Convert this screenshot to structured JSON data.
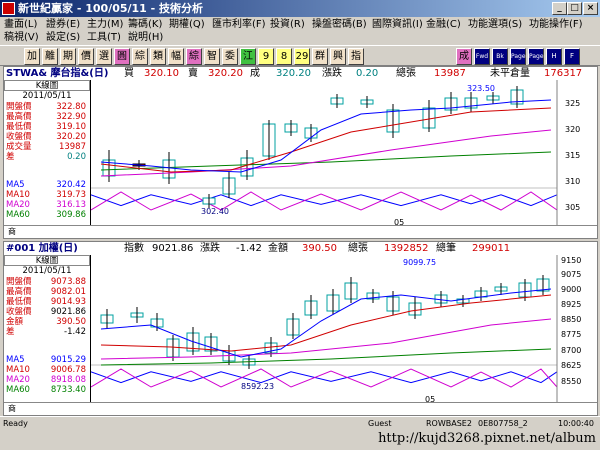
{
  "window": {
    "title": "新世紀贏家 - 100/05/11 - 技術分析"
  },
  "menus_row1": [
    "畫面(L)",
    "證券(E)",
    "主力(M)",
    "籌碼(K)",
    "期權(Q)",
    "匯市利率(F)",
    "投資(R)",
    "操盤密碼(B)",
    "國際資訊(I)",
    "金融(C)",
    "功能選項(S)",
    "功能操作(F)"
  ],
  "menus_row2": [
    "稿視(V)",
    "設定(S)",
    "工具(T)",
    "說明(H)"
  ],
  "toolbar": [
    "加",
    "離",
    "期",
    "價",
    "選",
    "圓",
    "綜",
    "類",
    "幅",
    "綜",
    "智",
    "委",
    "江",
    "9",
    "8",
    "29",
    "群",
    "興",
    "指"
  ],
  "toolbar_right": [
    "成",
    "Fwd",
    "Bk",
    "Page",
    "Page",
    "H",
    "F"
  ],
  "panel1": {
    "symbol": "STWA& 摩台指&(日)",
    "buy_label": "買",
    "buy": "320.10",
    "sell_label": "賣",
    "sell": "320.20",
    "deal_label": "成",
    "deal": "320.20",
    "chg_label": "漲跌",
    "chg": "0.20",
    "vol_label": "總張",
    "vol": "13987",
    "oi_label": "未平倉量",
    "oi": "176317",
    "k_label": "K線圖",
    "date": "2011/05/11",
    "rows": [
      {
        "label": "開盤價",
        "value": "322.80",
        "color": "#d00000"
      },
      {
        "label": "最高價",
        "value": "322.90",
        "color": "#d00000"
      },
      {
        "label": "最低價",
        "value": "319.10",
        "color": "#d00000"
      },
      {
        "label": "收盤價",
        "value": "320.20",
        "color": "#d00000"
      },
      {
        "label": "成交量",
        "value": "13987",
        "color": "#d00000"
      },
      {
        "label": "差",
        "value": "0.20",
        "color": "#d00000"
      }
    ],
    "ma": [
      {
        "label": "MA5",
        "value": "320.42",
        "color": "#0000ff"
      },
      {
        "label": "MA10",
        "value": "319.73",
        "color": "#d00000"
      },
      {
        "label": "MA20",
        "value": "316.13",
        "color": "#d000d0"
      },
      {
        "label": "MA60",
        "value": "309.86",
        "color": "#008000"
      }
    ],
    "hi_note": "323.50",
    "lo_note": "302.40",
    "xtick": "05",
    "bottom_label": "商",
    "y_ticks": [
      "325",
      "320",
      "315",
      "310",
      "305"
    ]
  },
  "panel2": {
    "symbol": "#001 加權(日)",
    "idx_label": "指數",
    "idx": "9021.86",
    "chg_label": "漲跌",
    "chg": "-1.42",
    "amt_label": "金額",
    "amt": "390.50",
    "vol_label": "總張",
    "vol": "1392852",
    "cnt_label": "總筆",
    "cnt": "299011",
    "k_label": "K線圖",
    "date": "2011/05/11",
    "rows": [
      {
        "label": "開盤價",
        "value": "9073.88",
        "color": "#d00000"
      },
      {
        "label": "最高價",
        "value": "9082.01",
        "color": "#d00000"
      },
      {
        "label": "最低價",
        "value": "9014.93",
        "color": "#d00000"
      },
      {
        "label": "收盤價",
        "value": "9021.86",
        "color": "#d00000"
      },
      {
        "label": "金額",
        "value": "390.50",
        "color": "#d00000"
      },
      {
        "label": "差",
        "value": "-1.42",
        "color": "#d00000"
      }
    ],
    "ma": [
      {
        "label": "MA5",
        "value": "9015.29",
        "color": "#0000ff"
      },
      {
        "label": "MA10",
        "value": "9006.78",
        "color": "#d00000"
      },
      {
        "label": "MA20",
        "value": "8918.08",
        "color": "#d000d0"
      },
      {
        "label": "MA60",
        "value": "8733.40",
        "color": "#008000"
      }
    ],
    "hi_note": "9099.75",
    "lo_note": "8592.23",
    "xtick": "05",
    "bottom_label": "商",
    "y_ticks": [
      "9150",
      "9075",
      "9000",
      "8925",
      "8850",
      "8775",
      "8700",
      "8625",
      "8550"
    ]
  },
  "status": {
    "ready": "Ready",
    "guest": "Guest",
    "server": "ROWBASE2",
    "code": "0E807758_2",
    "time": "10:00:40"
  },
  "watermark": "http://kujd3268.pixnet.net/album"
}
